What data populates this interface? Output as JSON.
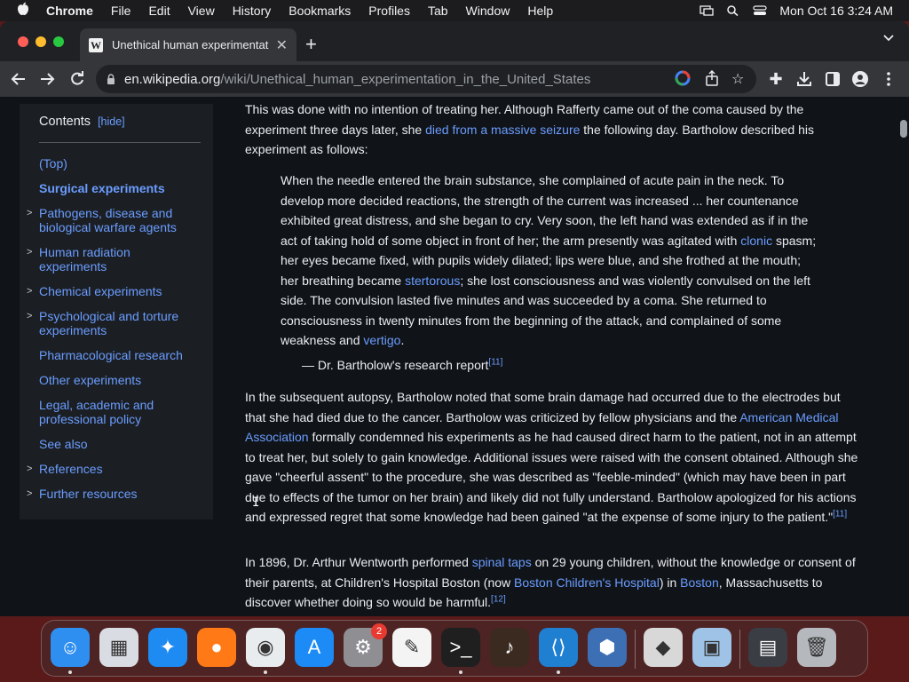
{
  "menubar": {
    "app_name": "Chrome",
    "items": [
      "File",
      "Edit",
      "View",
      "History",
      "Bookmarks",
      "Profiles",
      "Tab",
      "Window",
      "Help"
    ],
    "datetime": "Mon Oct 16  3:24 AM"
  },
  "tab": {
    "favicon_text": "W",
    "title": "Unethical human experimentat",
    "close": "✕"
  },
  "toolbar": {
    "url_domain": "en.wikipedia.org",
    "url_path": "/wiki/Unethical_human_experimentation_in_the_United_States"
  },
  "toc": {
    "header": "Contents",
    "hide_link": "[hide]",
    "items": [
      {
        "label": "(Top)",
        "bold": false,
        "expandable": false
      },
      {
        "label": "Surgical experiments",
        "bold": true,
        "expandable": false
      },
      {
        "label": "Pathogens, disease and biological warfare agents",
        "bold": false,
        "expandable": true
      },
      {
        "label": "Human radiation experiments",
        "bold": false,
        "expandable": true
      },
      {
        "label": "Chemical experiments",
        "bold": false,
        "expandable": true
      },
      {
        "label": "Psychological and torture experiments",
        "bold": false,
        "expandable": true
      },
      {
        "label": "Pharmacological research",
        "bold": false,
        "expandable": false
      },
      {
        "label": "Other experiments",
        "bold": false,
        "expandable": false
      },
      {
        "label": "Legal, academic and professional policy",
        "bold": false,
        "expandable": false
      },
      {
        "label": "See also",
        "bold": false,
        "expandable": false
      },
      {
        "label": "References",
        "bold": false,
        "expandable": true
      },
      {
        "label": "Further resources",
        "bold": false,
        "expandable": true
      }
    ]
  },
  "article": {
    "p1_a": "This was done with no intention of treating her. Although Rafferty came out of the coma caused by the experiment three days later, she ",
    "p1_link": "died from a massive seizure",
    "p1_b": " the following day. Bartholow described his experiment as follows:",
    "quote_a": "When the needle entered the brain substance, she complained of acute pain in the neck. To develop more decided reactions, the strength of the current was increased ... her countenance exhibited great distress, and she began to cry. Very soon, the left hand was extended as if in the act of taking hold of some object in front of her; the arm presently was agitated with ",
    "quote_link1": "clonic",
    "quote_b": " spasm; her eyes became fixed, with pupils widely dilated; lips were blue, and she frothed at the mouth; her breathing became ",
    "quote_link2": "stertorous",
    "quote_c": "; she lost consciousness and was violently convulsed on the left side. The convulsion lasted five minutes and was succeeded by a coma. She returned to consciousness in twenty minutes from the beginning of the attack, and complained of some weakness and ",
    "quote_link3": "vertigo",
    "quote_d": ".",
    "attribution": "— Dr. Bartholow's research report",
    "ref11": "[11]",
    "p2_a": "In the subsequent autopsy, Bartholow noted that some brain damage had occurred due to the electrodes but that she had died due to the cancer. Bartholow was criticized by fellow physicians and the ",
    "p2_link": "American Medical Association",
    "p2_b": " formally condemned his experiments as he had caused direct harm to the patient, not in an attempt to treat her, but solely to gain knowledge. Additional issues were raised with the consent obtained. Although she gave \"cheerful assent\" to the procedure, she was described as \"feeble-minded\" (which may have been in part due to effects of the tumor on her brain) and likely did not fully understand. Bartholow apologized for his actions and expressed regret that some knowledge had been gained \"at the expense of some injury to the patient.\"",
    "p3_a": "In 1896, Dr. Arthur Wentworth performed ",
    "p3_link1": "spinal taps",
    "p3_b": " on 29 young children, without the knowledge or consent of their parents, at Children's Hospital Boston (now ",
    "p3_link2": "Boston Children's Hospital",
    "p3_c": ") in ",
    "p3_link3": "Boston",
    "p3_d": ", Massachusetts to discover whether doing so would be harmful.",
    "ref12": "[12]"
  },
  "dock": {
    "apps": [
      {
        "name": "finder-icon",
        "color": "#2f8ff0",
        "glyph": "☺",
        "running": true
      },
      {
        "name": "launchpad-icon",
        "color": "#d9dde3",
        "glyph": "▦",
        "running": false
      },
      {
        "name": "safari-icon",
        "color": "#1e8bf2",
        "glyph": "✦",
        "running": false
      },
      {
        "name": "firefox-icon",
        "color": "#ff7a17",
        "glyph": "●",
        "running": false
      },
      {
        "name": "chrome-icon",
        "color": "#e9ecef",
        "glyph": "◉",
        "running": true
      },
      {
        "name": "app-store-icon",
        "color": "#1c8bf5",
        "glyph": "A",
        "running": false
      },
      {
        "name": "system-settings-icon",
        "color": "#8e8e93",
        "glyph": "⚙",
        "running": false,
        "badge": "2"
      },
      {
        "name": "textedit-icon",
        "color": "#f4f4f4",
        "glyph": "✎",
        "running": false
      },
      {
        "name": "terminal-icon",
        "color": "#1f1f1f",
        "glyph": ">_",
        "running": true
      },
      {
        "name": "garageband-icon",
        "color": "#3a2a20",
        "glyph": "♪",
        "running": false
      },
      {
        "name": "vscode-icon",
        "color": "#1f7fd1",
        "glyph": "⟨⟩",
        "running": true
      },
      {
        "name": "virtualbox-icon",
        "color": "#3c6fb4",
        "glyph": "⬢",
        "running": false
      },
      {
        "name": "roblox-icon",
        "color": "#d8d8d8",
        "glyph": "◆",
        "running": false
      },
      {
        "name": "preview-icon",
        "color": "#9ec3e6",
        "glyph": "▣",
        "running": false
      },
      {
        "name": "downloads-stack-icon",
        "color": "#3a3d44",
        "glyph": "▤",
        "running": false
      },
      {
        "name": "trash-icon",
        "color": "#b5b8bd",
        "glyph": "🗑",
        "running": false
      }
    ]
  }
}
